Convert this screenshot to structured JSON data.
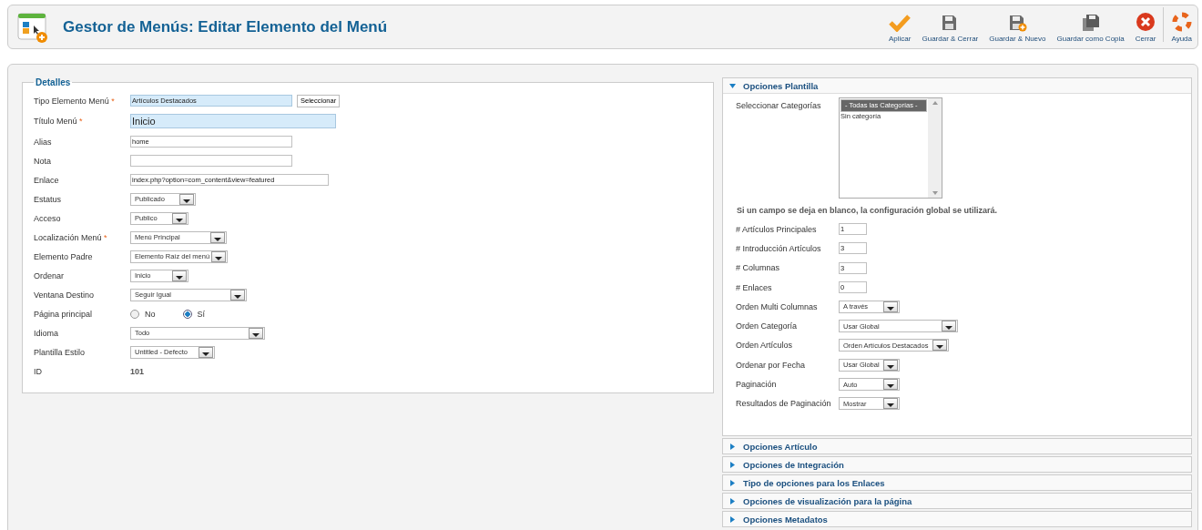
{
  "header": {
    "title": "Gestor de Menús: Editar Elemento del Menú"
  },
  "toolbar": [
    {
      "label": "Aplicar",
      "kind": "check"
    },
    {
      "label": "Guardar & Cerrar",
      "kind": "save"
    },
    {
      "label": "Guardar & Nuevo",
      "kind": "save-new"
    },
    {
      "label": "Guardar como Copia",
      "kind": "save-copy"
    },
    {
      "label": "Cerrar",
      "kind": "close"
    },
    {
      "label": "Ayuda",
      "kind": "help"
    }
  ],
  "details": {
    "legend": "Detalles",
    "fields": [
      {
        "label": "Tipo Elemento Menú",
        "mark": "*",
        "kind": "text",
        "value": "Artículos Destacados",
        "highlighted": true,
        "button": "Seleccionar"
      },
      {
        "label": "Título Menú",
        "mark": "*",
        "kind": "text",
        "value": "Inicio",
        "highlighted": true
      },
      {
        "label": "Alias",
        "kind": "text",
        "value": "home",
        "highlighted": false
      },
      {
        "label": "Nota",
        "kind": "text",
        "highlighted": false
      },
      {
        "label": "Enlace",
        "kind": "text",
        "value": "index.php?option=com_content&view=featured",
        "highlighted": false
      },
      {
        "label": "Estatus",
        "kind": "select",
        "value": "Publicado"
      },
      {
        "label": "Acceso",
        "kind": "select",
        "value": "Publico"
      },
      {
        "label": "Localización Menú",
        "mark": "*",
        "kind": "select",
        "value": "Menú Principal"
      },
      {
        "label": "Elemento Padre",
        "kind": "select",
        "value": "Elemento Raíz del menú"
      },
      {
        "label": "Ordenar",
        "kind": "select",
        "value": "Inicio"
      },
      {
        "label": "Ventana Destino",
        "kind": "select",
        "value": "Seguir Igual"
      },
      {
        "label": "Página principal",
        "kind": "radio",
        "options": [
          {
            "label": "No",
            "selected": false
          },
          {
            "label": "Sí",
            "selected": true
          }
        ]
      },
      {
        "label": "Idioma",
        "kind": "select",
        "value": "Todo"
      },
      {
        "label": "Plantilla Estilo",
        "kind": "select",
        "value": "Untitled - Defecto"
      },
      {
        "label": "ID",
        "kind": "static",
        "value": "101"
      }
    ]
  },
  "panels": [
    {
      "title": "Opciones Plantilla",
      "expanded": true,
      "category_label": "Seleccionar Categorías",
      "categories": [
        {
          "label": "- Todas las Categorías -",
          "selected": true
        },
        {
          "label": "Sin categoría",
          "selected": false
        }
      ],
      "note": "Si un campo se deja en blanco, la configuración global se utilizará.",
      "fields": [
        {
          "label": "# Artículos Principales",
          "kind": "text",
          "value": "1"
        },
        {
          "label": "# Introducción Artículos",
          "kind": "text",
          "value": "3"
        },
        {
          "label": "# Columnas",
          "kind": "text",
          "value": "3"
        },
        {
          "label": "# Enlaces",
          "kind": "text",
          "value": "0"
        },
        {
          "label": "Orden Multi Columnas",
          "kind": "select",
          "value": "A través"
        },
        {
          "label": "Orden Categoría",
          "kind": "select",
          "value": "Usar Global"
        },
        {
          "label": "Orden Artículos",
          "kind": "select",
          "value": "Orden Artículos Destacados"
        },
        {
          "label": "Ordenar por Fecha",
          "kind": "select",
          "value": "Usar Global"
        },
        {
          "label": "Paginación",
          "kind": "select",
          "value": "Auto"
        },
        {
          "label": "Resultados de Paginación",
          "kind": "select",
          "value": "Mostrar"
        }
      ]
    },
    {
      "title": "Opciones Artículo",
      "expanded": false
    },
    {
      "title": "Opciones de Integración",
      "expanded": false
    },
    {
      "title": "Tipo de opciones para los Enlaces",
      "expanded": false
    },
    {
      "title": "Opciones de visualización para la página",
      "expanded": false
    },
    {
      "title": "Opciones Metadatos",
      "expanded": false
    }
  ]
}
